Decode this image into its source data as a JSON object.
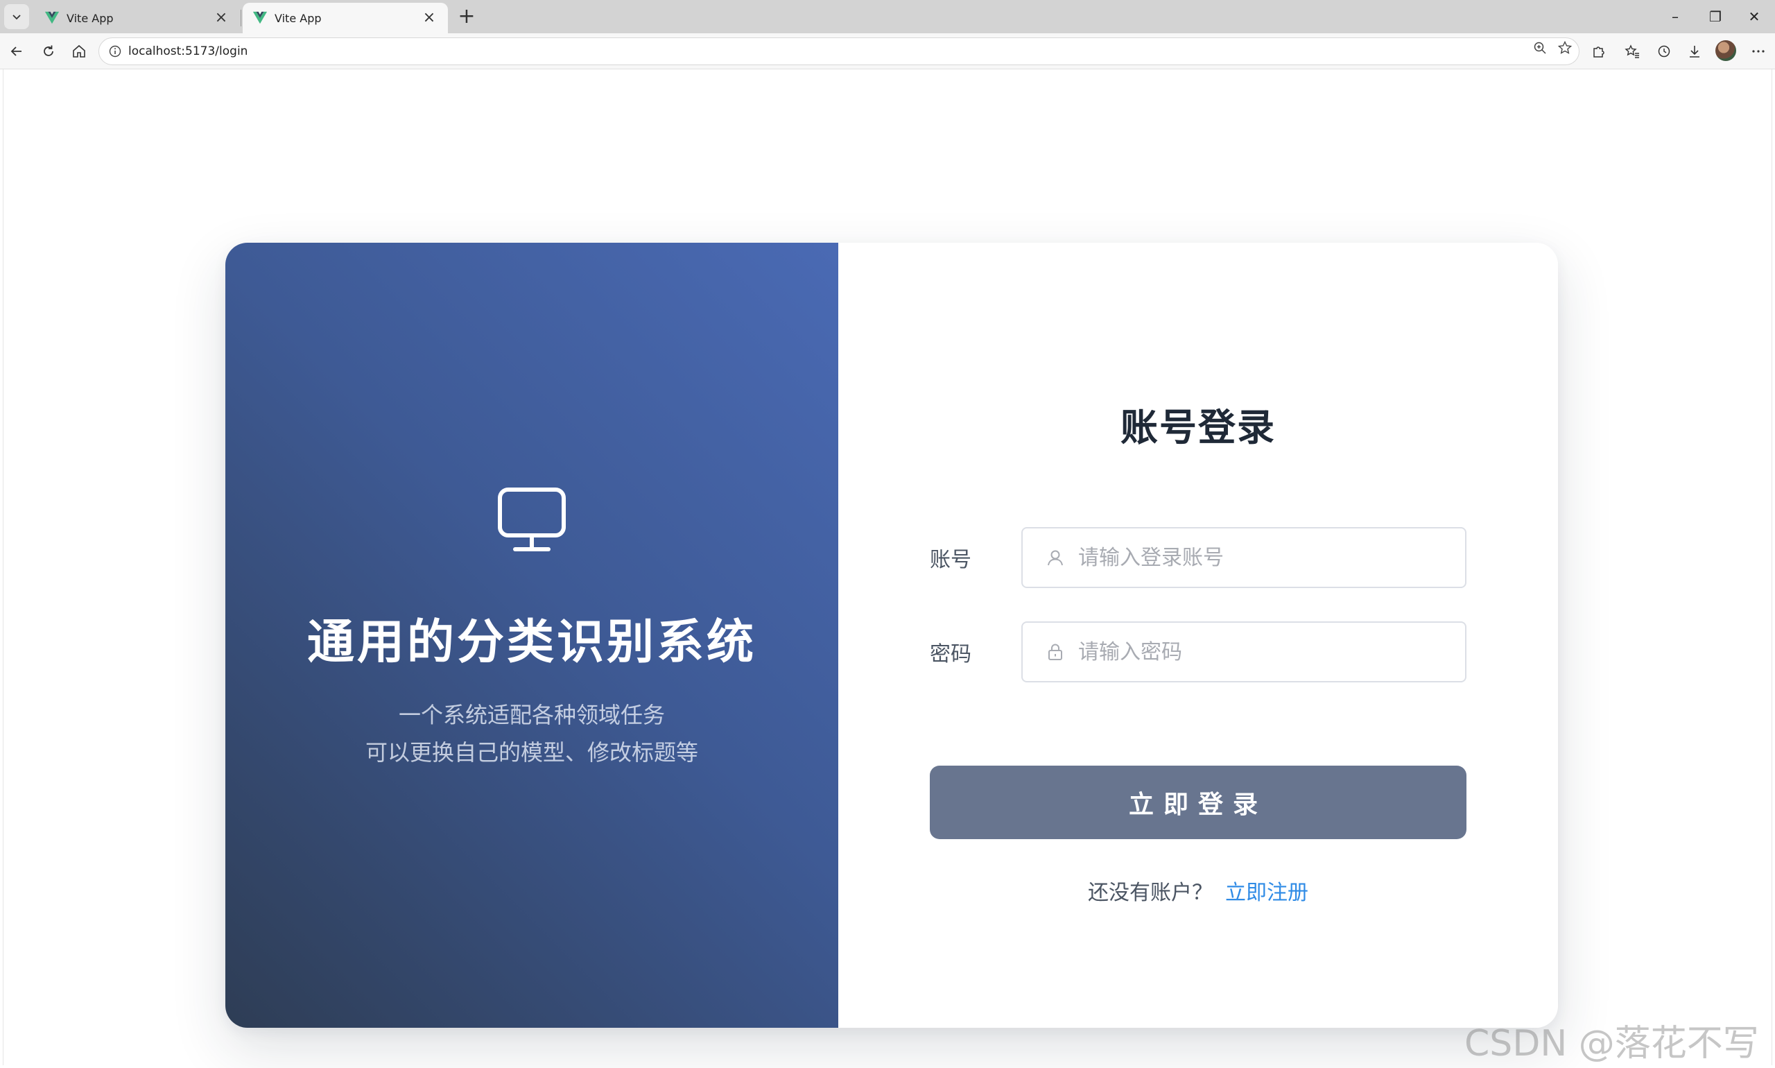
{
  "browser": {
    "tabs": [
      {
        "title": "Vite App",
        "active": false
      },
      {
        "title": "Vite App",
        "active": true
      }
    ],
    "new_tab": "+",
    "url": "localhost:5173/login",
    "window_controls": {
      "minimize": "–",
      "restore": "❐",
      "close": "✕"
    }
  },
  "left": {
    "icon": "monitor-icon",
    "title": "通用的分类识别系统",
    "subtitle_line1": "一个系统适配各种领域任务",
    "subtitle_line2": "可以更换自己的模型、修改标题等"
  },
  "login": {
    "title": "账号登录",
    "account_label": "账号",
    "account_placeholder": "请输入登录账号",
    "account_value": "",
    "password_label": "密码",
    "password_placeholder": "请输入密码",
    "password_value": "",
    "submit_label": "立即登录",
    "register_prompt": "还没有账户？",
    "register_link": "立即注册"
  },
  "watermark": "CSDN @落花不写码",
  "colors": {
    "panel_gradient_start": "#4a6ab4",
    "panel_gradient_end": "#2e3d55",
    "button": "#68758f",
    "link": "#2f8be6"
  }
}
